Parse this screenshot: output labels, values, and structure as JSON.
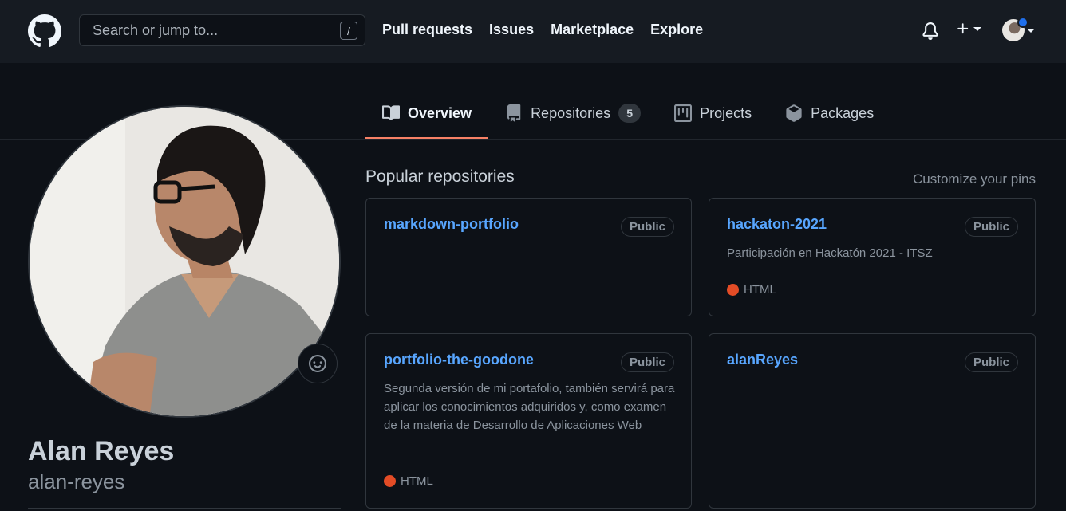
{
  "header": {
    "search_placeholder": "Search or jump to...",
    "search_shortcut": "/",
    "nav": [
      "Pull requests",
      "Issues",
      "Marketplace",
      "Explore"
    ],
    "plus_label": "+"
  },
  "tabs": [
    {
      "label": "Overview",
      "icon": "book-icon",
      "active": true
    },
    {
      "label": "Repositories",
      "icon": "repo-icon",
      "count": "5"
    },
    {
      "label": "Projects",
      "icon": "project-icon"
    },
    {
      "label": "Packages",
      "icon": "package-icon"
    }
  ],
  "profile": {
    "name": "Alan Reyes",
    "login": "alan-reyes"
  },
  "popular": {
    "title": "Popular repositories",
    "customize": "Customize your pins",
    "repos": [
      {
        "name": "markdown-portfolio",
        "visibility": "Public",
        "description": "",
        "language": ""
      },
      {
        "name": "hackaton-2021",
        "visibility": "Public",
        "description": "Participación en Hackatón 2021 - ITSZ",
        "language": "HTML"
      },
      {
        "name": "portfolio-the-goodone",
        "visibility": "Public",
        "description": "Segunda versión de mi portafolio, también servirá para aplicar los conocimientos adquiridos y, como examen de la materia de Desarrollo de Aplicaciones Web",
        "language": "HTML"
      },
      {
        "name": "alanReyes",
        "visibility": "Public",
        "description": "",
        "language": ""
      }
    ]
  },
  "colors": {
    "accent_tab": "#f78166",
    "link": "#58a6ff",
    "html_lang": "#e34c26",
    "notification_dot": "#1f6feb"
  }
}
